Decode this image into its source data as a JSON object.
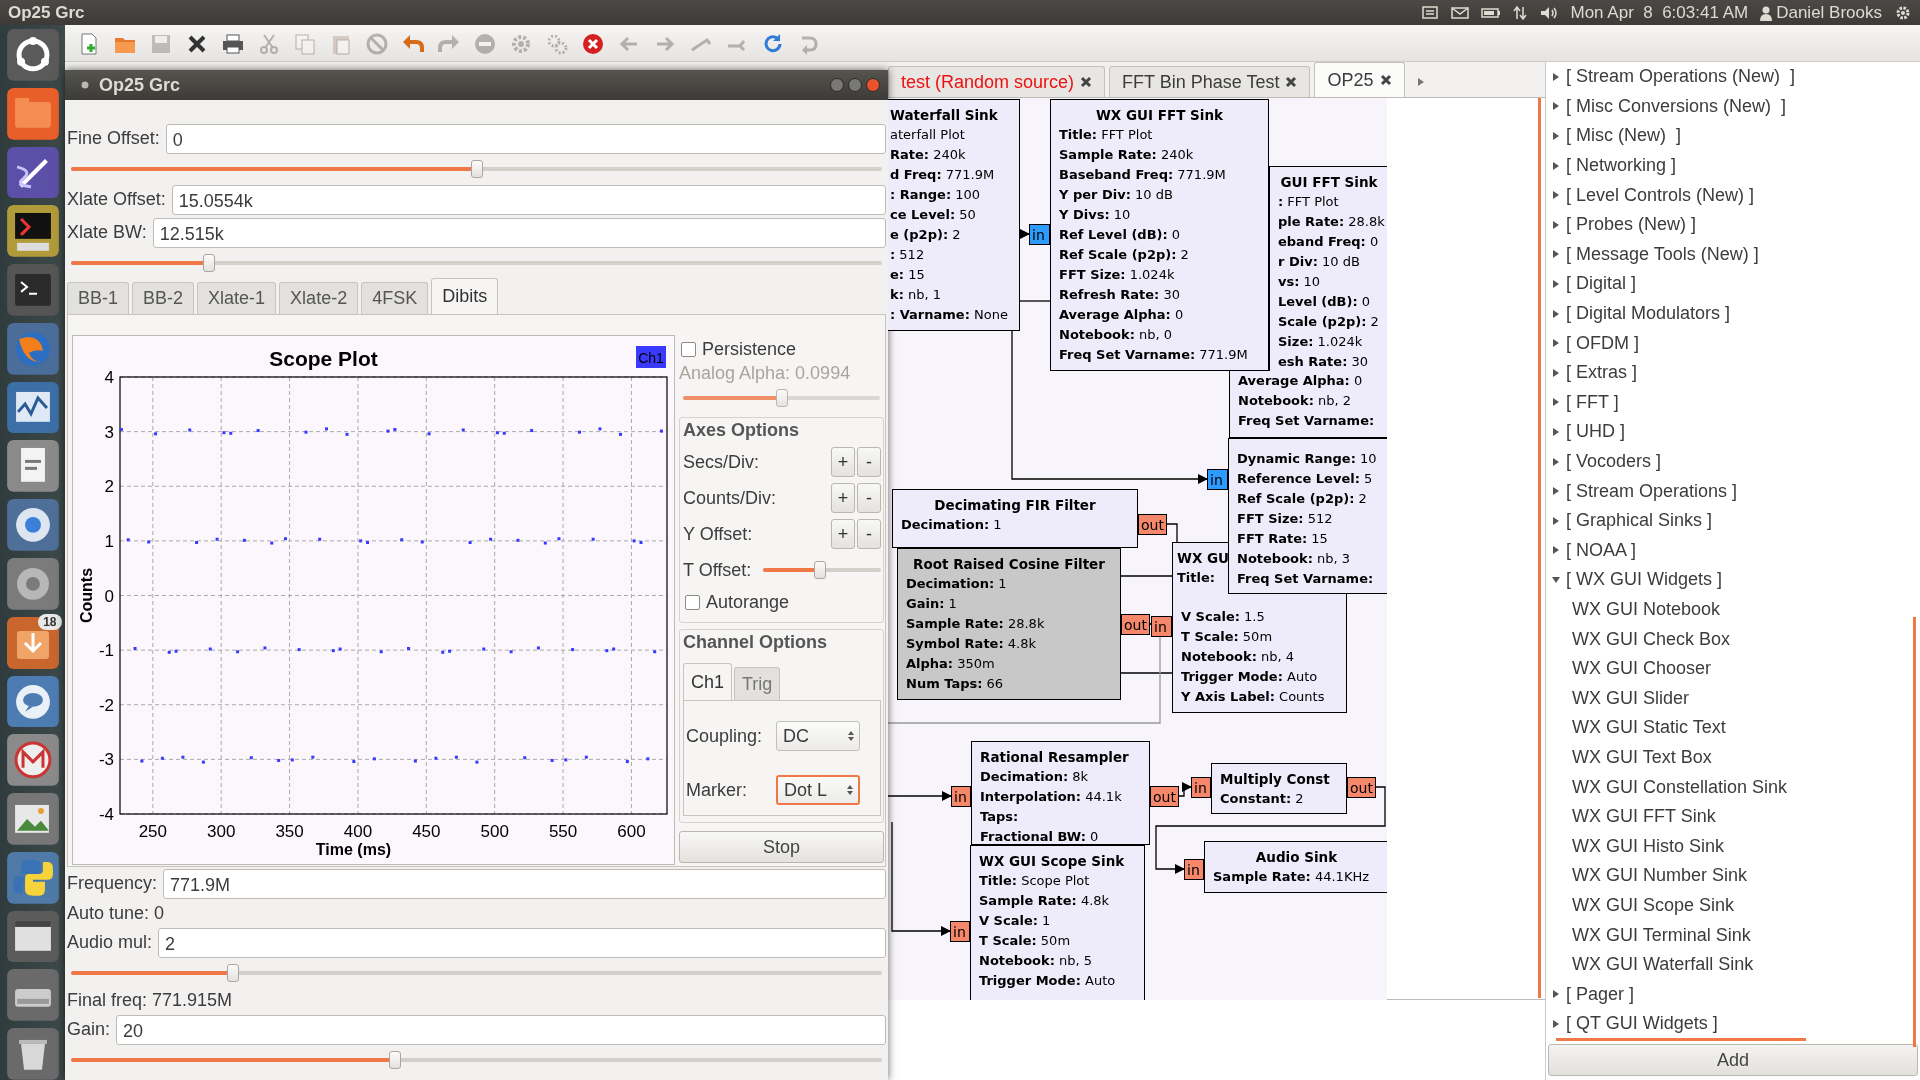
{
  "top_panel": {
    "app_title": "Op25 Grc",
    "clock": "Mon Apr  8  6:03:41 AM",
    "user": "Daniel Brooks"
  },
  "launcher": {
    "badge": "18"
  },
  "toolbar": [
    {
      "kind": "new",
      "disabled": false
    },
    {
      "kind": "open",
      "disabled": false
    },
    {
      "kind": "save",
      "disabled": true
    },
    {
      "kind": "close",
      "disabled": false
    },
    {
      "kind": "print",
      "disabled": false
    },
    {
      "kind": "cut",
      "disabled": true
    },
    {
      "kind": "copy",
      "disabled": true
    },
    {
      "kind": "paste",
      "disabled": true
    },
    {
      "kind": "delete",
      "disabled": true
    },
    {
      "kind": "undo",
      "disabled": false
    },
    {
      "kind": "redo",
      "disabled": true
    },
    {
      "kind": "disable",
      "disabled": true
    },
    {
      "kind": "enable",
      "disabled": true
    },
    {
      "kind": "bypass",
      "disabled": true
    },
    {
      "kind": "kill",
      "disabled": false
    },
    {
      "kind": "back",
      "disabled": true
    },
    {
      "kind": "forward",
      "disabled": true
    },
    {
      "kind": "rotate_ccw",
      "disabled": true
    },
    {
      "kind": "rotate_cw",
      "disabled": true
    },
    {
      "kind": "reload",
      "disabled": false
    },
    {
      "kind": "find",
      "disabled": true
    }
  ],
  "document_tabs": [
    {
      "label": "test (Random source)",
      "selected": false,
      "error": true
    },
    {
      "label": "FFT Bin Phase Test",
      "selected": false,
      "error": false
    },
    {
      "label": "OP25",
      "selected": true,
      "error": false
    }
  ],
  "flowgraph": {
    "blocks": [
      {
        "title": "Waterfall Sink",
        "disabled": false,
        "lines": [
          "aterfall Plot",
          "**Rate:** 240k",
          "**d Freq:** 771.9M",
          "**: Range:** 100",
          "**ce Level:** 50",
          "**e (p2p):** 2",
          "**:** 512",
          "**e:** 15",
          "**k:** nb, 1",
          "**: Varname:** None"
        ]
      },
      {
        "title": "WX GUI FFT Sink",
        "disabled": false,
        "lines": [
          "**Title:** FFT Plot",
          "**Sample Rate:** 240k",
          "**Baseband Freq:** 771.9M",
          "**Y per Div:** 10 dB",
          "**Y Divs:** 10",
          "**Ref Level (dB):** 0",
          "**Ref Scale (p2p):** 2",
          "**FFT Size:** 1.024k",
          "**Refresh Rate:** 30",
          "**Average Alpha:** 0",
          "**Notebook:** nb, 0",
          "**Freq Set Varname:** 771.9M"
        ],
        "ports": [
          {
            "label": "in",
            "color": "#2e9bff"
          }
        ]
      },
      {
        "title": "GUI FFT Sink",
        "disabled": false,
        "lines": [
          "**:** FFT Plot",
          "**ple Rate:** 28.8k",
          "**eband Freq:** 0",
          "**r Div:** 10 dB",
          "**vs:** 10",
          "**Level (dB):** 0",
          "**Scale (p2p):** 2",
          "**Size:** 1.024k",
          "**esh Rate:** 30",
          "**Average Alpha:** 0",
          "**Notebook:** nb, 2",
          "**Freq Set Varname:**"
        ]
      },
      {
        "title": "Decimating FIR Filter",
        "disabled": false,
        "lines": [
          "**Decimation:** 1"
        ],
        "ports": [
          {
            "label": "out",
            "color": "#f5876a"
          }
        ]
      },
      {
        "title": "Root Raised Cosine Filter",
        "disabled": true,
        "lines": [
          "**Decimation:** 1",
          "**Gain:** 1",
          "**Sample Rate:** 28.8k",
          "**Symbol Rate:** 4.8k",
          "**Alpha:** 350m",
          "**Num Taps:** 66"
        ],
        "ports": [
          {
            "label": "out",
            "color": "#f5876a"
          }
        ]
      },
      {
        "disabled": false,
        "lines": [
          "**Dynamic Range:** 10",
          "**Reference Level:** 5",
          "**Ref Scale (p2p):** 2",
          "**FFT Size:** 512",
          "**FFT Rate:** 15",
          "**Notebook:** nb, 3",
          "**Freq Set Varname:**"
        ],
        "ports": [
          {
            "label": "in",
            "color": "#2e9bff"
          }
        ]
      },
      {
        "title": "WX GU",
        "disabled": false,
        "lines": [
          "**Title:**",
          "**V Scale:** 1.5",
          "**T Scale:** 50m",
          "**Notebook:** nb, 4",
          "**Trigger Mode:** Auto",
          "**Y Axis Label:** Counts"
        ],
        "ports": [
          {
            "label": "in",
            "color": "#f5876a"
          }
        ]
      },
      {
        "title": "Rational Resampler",
        "disabled": false,
        "lines": [
          "**Decimation:** 8k",
          "**Interpolation:** 44.1k",
          "**Taps:**",
          "**Fractional BW:** 0"
        ],
        "ports": [
          {
            "label": "in",
            "color": "#f5876a"
          },
          {
            "label": "out",
            "color": "#f5876a"
          }
        ]
      },
      {
        "title": "WX GUI Scope Sink",
        "disabled": false,
        "lines": [
          "**Title:** Scope Plot",
          "**Sample Rate:** 4.8k",
          "**V Scale:** 1",
          "**T Scale:** 50m",
          "**Notebook:** nb, 5",
          "**Trigger Mode:** Auto"
        ],
        "ports": [
          {
            "label": "in",
            "color": "#f5876a"
          }
        ]
      },
      {
        "title": "Multiply Const",
        "disabled": false,
        "lines": [
          "**Constant:** 2"
        ],
        "ports": [
          {
            "label": "in",
            "color": "#f5876a"
          },
          {
            "label": "out",
            "color": "#f5876a"
          }
        ]
      },
      {
        "title": "Audio Sink",
        "disabled": false,
        "lines": [
          "**Sample Rate:** 44.1KHz"
        ],
        "ports": [
          {
            "label": "in",
            "color": "#f5876a"
          }
        ]
      }
    ]
  },
  "block_tree": {
    "items": [
      {
        "label": "[ Stream Operations (New)  ]",
        "expanded": false
      },
      {
        "label": "[ Misc Conversions (New)  ]",
        "expanded": false
      },
      {
        "label": "[ Misc (New)  ]",
        "expanded": false
      },
      {
        "label": "[ Networking ]",
        "expanded": false
      },
      {
        "label": "[ Level Controls (New) ]",
        "expanded": false
      },
      {
        "label": "[ Probes (New) ]",
        "expanded": false
      },
      {
        "label": "[ Message Tools (New) ]",
        "expanded": false
      },
      {
        "label": "[ Digital ]",
        "expanded": false
      },
      {
        "label": "[ Digital Modulators ]",
        "expanded": false
      },
      {
        "label": "[ OFDM ]",
        "expanded": false
      },
      {
        "label": "[ Extras ]",
        "expanded": false
      },
      {
        "label": "[ FFT ]",
        "expanded": false
      },
      {
        "label": "[ UHD ]",
        "expanded": false
      },
      {
        "label": "[ Vocoders ]",
        "expanded": false
      },
      {
        "label": "[ Stream Operations ]",
        "expanded": false
      },
      {
        "label": "[ Graphical Sinks ]",
        "expanded": false
      },
      {
        "label": "[ NOAA ]",
        "expanded": false
      },
      {
        "label": "[ WX GUI Widgets ]",
        "expanded": true,
        "children": [
          {
            "label": "WX GUI Notebook"
          },
          {
            "label": "WX GUI Check Box"
          },
          {
            "label": "WX GUI Chooser"
          },
          {
            "label": "WX GUI Slider"
          },
          {
            "label": "WX GUI Static Text"
          },
          {
            "label": "WX GUI Text Box"
          },
          {
            "label": "WX GUI Constellation Sink"
          },
          {
            "label": "WX GUI FFT Sink"
          },
          {
            "label": "WX GUI Histo Sink"
          },
          {
            "label": "WX GUI Number Sink"
          },
          {
            "label": "WX GUI Scope Sink"
          },
          {
            "label": "WX GUI Terminal Sink"
          },
          {
            "label": "WX GUI Waterfall Sink"
          }
        ]
      },
      {
        "label": "[ Pager ]",
        "expanded": false
      },
      {
        "label": "[ QT GUI Widgets ]",
        "expanded": false
      }
    ],
    "add_button": "Add"
  },
  "dialog": {
    "title": "Op25 Grc",
    "controls_top": [
      {
        "kind": "field",
        "label": "Fine Offset:",
        "value": "0"
      },
      {
        "kind": "slider",
        "level": 0.5
      },
      {
        "kind": "field",
        "label": "Xlate Offset:",
        "value": "15.0554k"
      },
      {
        "kind": "field",
        "label": "Xlate BW:",
        "value": "12.515k"
      },
      {
        "kind": "slider",
        "level": 0.17
      }
    ],
    "tabs": [
      {
        "label": "BB-1",
        "selected": false
      },
      {
        "label": "BB-2",
        "selected": false
      },
      {
        "label": "Xlate-1",
        "selected": false
      },
      {
        "label": "Xlate-2",
        "selected": false
      },
      {
        "label": "4FSK",
        "selected": false
      },
      {
        "label": "Dibits",
        "selected": true
      }
    ],
    "scope": {
      "chart_data": {
        "type": "scatter",
        "grid": true,
        "title": "Scope Plot",
        "xlabel": "Time (ms)",
        "ylabel": "Counts",
        "xlim": [
          226,
          626
        ],
        "ylim": [
          -4,
          4
        ],
        "xticks": [
          250,
          300,
          350,
          400,
          450,
          500,
          550,
          600
        ],
        "yticks": [
          -4,
          -3,
          -2,
          -1,
          0,
          1,
          2,
          3,
          4
        ],
        "x": [
          227,
          232,
          237,
          242,
          247,
          252,
          257,
          262,
          267,
          272,
          277,
          282,
          287,
          292,
          297,
          302,
          307,
          312,
          317,
          322,
          327,
          332,
          337,
          342,
          347,
          352,
          357,
          362,
          367,
          372,
          377,
          382,
          387,
          392,
          397,
          402,
          407,
          412,
          417,
          422,
          427,
          432,
          437,
          442,
          447,
          452,
          457,
          462,
          467,
          472,
          477,
          482,
          487,
          492,
          497,
          502,
          507,
          512,
          517,
          522,
          527,
          532,
          537,
          542,
          547,
          552,
          557,
          562,
          567,
          572,
          577,
          582,
          587,
          592,
          597,
          602,
          607,
          612,
          617,
          622
        ],
        "series": [
          {
            "name": "Ch1",
            "color": "#3a3aff",
            "values": [
              3.04,
              1.02,
              -0.97,
              -3.03,
              0.98,
              2.96,
              -2.98,
              -1.04,
              -1.02,
              -2.96,
              3.03,
              0.97,
              -3.05,
              -0.98,
              1.03,
              2.98,
              2.97,
              -1.03,
              1.01,
              -2.97,
              3.02,
              -0.96,
              0.96,
              -3.02,
              1.04,
              -3.01,
              -0.99,
              2.99,
              -2.96,
              1.03,
              3.05,
              -1.01,
              -0.98,
              2.95,
              -3.04,
              1.0,
              0.97,
              -2.99,
              -1.03,
              3.01,
              3.04,
              1.02,
              -0.97,
              -3.03,
              0.98,
              2.96,
              -2.98,
              -1.04,
              -1.02,
              -2.96,
              3.03,
              0.97,
              -3.05,
              -0.98,
              1.03,
              2.98,
              2.97,
              -1.03,
              1.01,
              -2.97,
              3.02,
              -0.96,
              0.96,
              -3.02,
              1.04,
              -3.01,
              -0.99,
              2.99,
              -2.96,
              1.03,
              3.05,
              -1.01,
              -0.98,
              2.95,
              -3.04,
              1.0,
              0.97,
              -2.99,
              -1.03,
              3.01
            ]
          }
        ]
      },
      "persistence": {
        "label": "Persistence",
        "checked": false
      },
      "analog_alpha": {
        "label": "Analog Alpha: 0.0994",
        "disabled": true,
        "level": 0.5
      },
      "axes_options": {
        "title": "Axes Options",
        "rows": [
          {
            "label": "Secs/Div:",
            "buttons": [
              "+",
              "-"
            ]
          },
          {
            "label": "Counts/Div:",
            "buttons": [
              "+",
              "-"
            ]
          },
          {
            "label": "Y Offset:",
            "buttons": [
              "+",
              "-"
            ]
          }
        ],
        "t_offset": {
          "label": "T Offset:",
          "level": 0.48
        },
        "autorange": {
          "label": "Autorange",
          "checked": false
        }
      },
      "channel_options": {
        "title": "Channel Options",
        "tabs": [
          {
            "label": "Ch1",
            "selected": true
          },
          {
            "label": "Trig",
            "selected": false
          }
        ],
        "coupling": {
          "label": "Coupling:",
          "value": "DC",
          "focused": false
        },
        "marker": {
          "label": "Marker:",
          "value": "Dot L",
          "focused": true
        }
      },
      "stop": "Stop"
    },
    "controls_bottom": [
      {
        "kind": "field",
        "label": "Frequency:",
        "value": "771.9M"
      },
      {
        "kind": "text",
        "text": "Auto tune: 0"
      },
      {
        "kind": "field",
        "label": "Audio mul:",
        "value": "2"
      },
      {
        "kind": "slider",
        "level": 0.2
      },
      {
        "kind": "text",
        "text": "Final freq: 771.915M"
      },
      {
        "kind": "field",
        "label": "Gain:",
        "value": "20"
      },
      {
        "kind": "slider",
        "level": 0.4
      }
    ]
  }
}
